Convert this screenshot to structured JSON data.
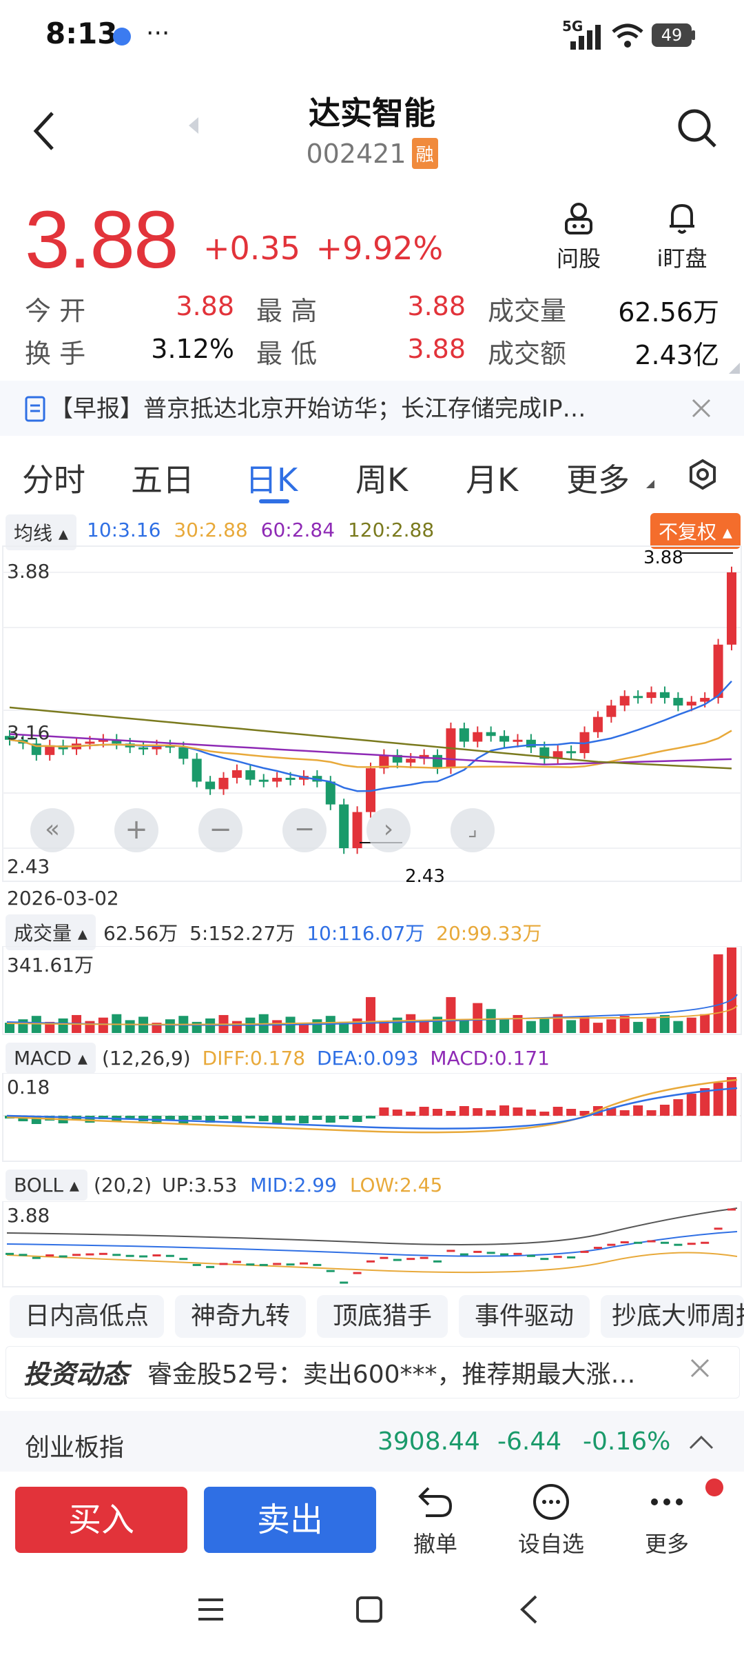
{
  "status": {
    "time": "8:13",
    "battery": "49",
    "network": "5G"
  },
  "header": {
    "title": "达实智能",
    "code": "002421",
    "margin_badge": "融"
  },
  "price": {
    "last": "3.88",
    "change": "+0.35",
    "change_pct": "+9.92%"
  },
  "actions": {
    "ask": "问股",
    "watch": "i盯盘"
  },
  "quote": {
    "open_label": "今  开",
    "open": "3.88",
    "high_label": "最  高",
    "high": "3.88",
    "volume_label": "成交量",
    "volume": "62.56万",
    "turnover_label": "换  手",
    "turnover": "3.12%",
    "low_label": "最  低",
    "low": "3.88",
    "amount_label": "成交额",
    "amount": "2.43亿"
  },
  "news": {
    "text": "【早报】普京抵达北京开始访华；长江存储完成IP…"
  },
  "tabs": [
    "分时",
    "五日",
    "日K",
    "周K",
    "月K",
    "更多"
  ],
  "ma_row": {
    "label": "均线",
    "ma10": "10:3.16",
    "ma30": "30:2.88",
    "ma60": "60:2.84",
    "ma120": "120:2.88",
    "adjust": "不复权"
  },
  "kline": {
    "top_price": "3.88",
    "mid_price": "3.16",
    "low_price": "2.43",
    "date": "2026-03-02",
    "max_mark": "3.88",
    "min_mark": "2.43"
  },
  "volume_row": {
    "label": "成交量",
    "v": "62.56万",
    "v5": "5:152.27万",
    "v10": "10:116.07万",
    "v20": "20:99.33万",
    "max": "341.61万"
  },
  "macd_row": {
    "label": "MACD",
    "params": "(12,26,9)",
    "diff": "DIFF:0.178",
    "dea": "DEA:0.093",
    "macd": "MACD:0.171",
    "max": "0.18"
  },
  "boll_row": {
    "label": "BOLL",
    "params": "(20,2)",
    "up": "UP:3.53",
    "mid": "MID:2.99",
    "low": "LOW:2.45",
    "max": "3.88"
  },
  "strategies": [
    "日内高低点",
    "神奇九转",
    "顶底猎手",
    "事件驱动",
    "抄底大师周报"
  ],
  "invest": {
    "logo": "投资动态",
    "text": "睿金股52号：卖出600***，推荐期最大涨…"
  },
  "index": {
    "name": "创业板指",
    "value": "3908.44",
    "change": "-6.44",
    "pct": "-0.16%"
  },
  "bottom": {
    "buy": "买入",
    "sell": "卖出",
    "cancel": "撤单",
    "favorite": "设自选",
    "more": "更多"
  },
  "colors": {
    "up": "#e2333a",
    "down": "#1a9a6a",
    "blue": "#2f6fe4",
    "accent": "#f08a3c"
  }
}
